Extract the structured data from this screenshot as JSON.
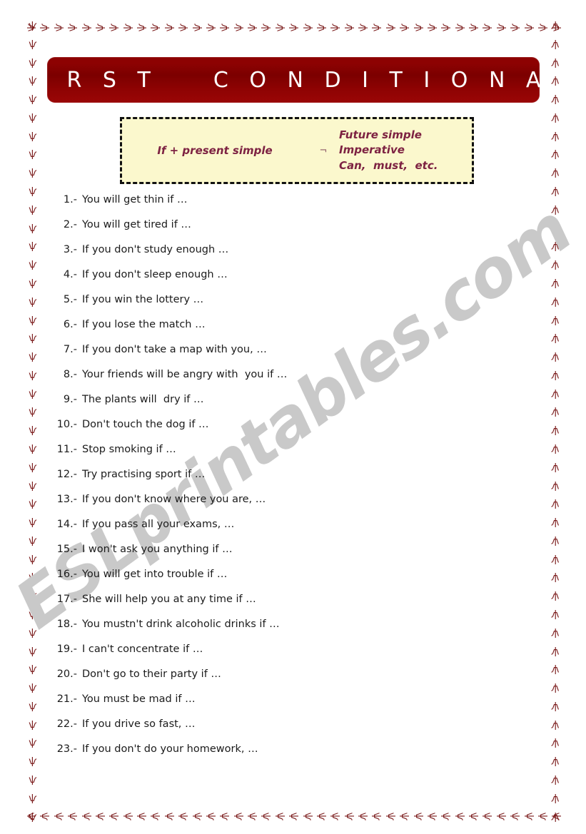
{
  "document": {
    "title": "F I R S T    C O N D I T I O N A L",
    "watermark": "ESLprintables.com"
  },
  "formula": {
    "left": "If + present simple",
    "arrow": "¬",
    "right": [
      "Future simple",
      "Imperative",
      "Can,  must,  etc."
    ]
  },
  "border": {
    "glyph": "ѱ",
    "color": "#7a1a1a"
  },
  "colors": {
    "banner_background": "#8a0000",
    "banner_text": "#ffffff",
    "formula_background": "#fbf8cd",
    "formula_text": "#7d2242",
    "formula_border": "#111111",
    "body_text": "#1b1b1b",
    "watermark": "#c9c9c9"
  },
  "exercises": [
    {
      "number": "1.-",
      "text": "You will get thin if …"
    },
    {
      "number": "2.-",
      "text": "You will get tired if …"
    },
    {
      "number": "3.-",
      "text": "If you don't study enough …"
    },
    {
      "number": "4.-",
      "text": "If you don't sleep enough …"
    },
    {
      "number": "5.-",
      "text": "If you win the lottery …"
    },
    {
      "number": "6.-",
      "text": "If you lose the match …"
    },
    {
      "number": "7.-",
      "text": "If you don't take a map with you, …"
    },
    {
      "number": "8.-",
      "text": "Your friends will be angry with  you if …"
    },
    {
      "number": "9.-",
      "text": "The plants will  dry if …"
    },
    {
      "number": "10.-",
      "text": "Don't touch the dog if …"
    },
    {
      "number": "11.-",
      "text": "Stop smoking if …"
    },
    {
      "number": "12.-",
      "text": "Try practising sport if …"
    },
    {
      "number": "13.-",
      "text": "If you don't know where you are, …"
    },
    {
      "number": "14.-",
      "text": "If you pass all your exams, …"
    },
    {
      "number": "15.-",
      "text": "I won't ask you anything if …"
    },
    {
      "number": "16.-",
      "text": "You will get into trouble if …"
    },
    {
      "number": "17.-",
      "text": "She will help you at any time if …"
    },
    {
      "number": "18.-",
      "text": "You mustn't drink alcoholic drinks if …"
    },
    {
      "number": "19.-",
      "text": "I can't concentrate if …"
    },
    {
      "number": "20.-",
      "text": "Don't go to their party if …"
    },
    {
      "number": "21.-",
      "text": "You must be mad if …"
    },
    {
      "number": "22.-",
      "text": "If you drive so fast, …"
    },
    {
      "number": "23.-",
      "text": "If you don't do your homework, …"
    }
  ]
}
